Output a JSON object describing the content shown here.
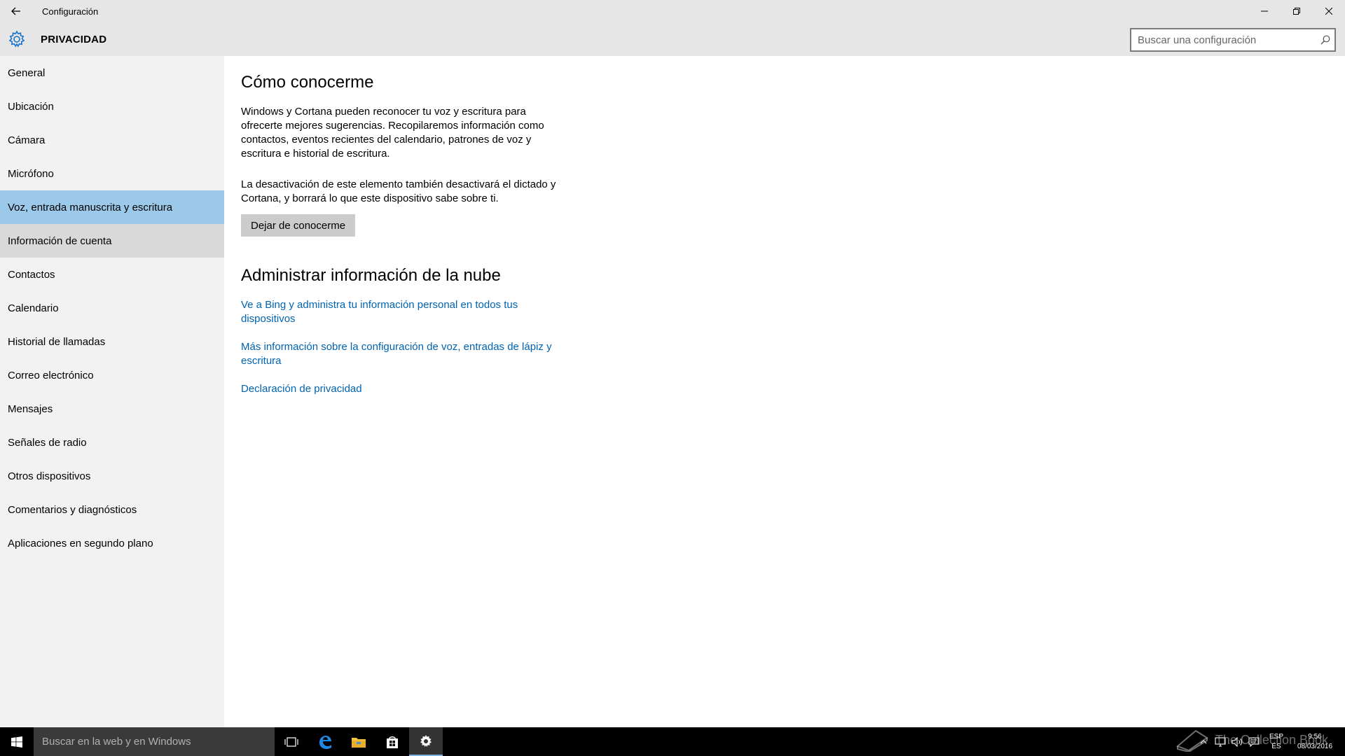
{
  "window": {
    "title": "Configuración"
  },
  "header": {
    "title": "PRIVACIDAD",
    "search_placeholder": "Buscar una configuración"
  },
  "sidebar": {
    "items": [
      {
        "label": "General"
      },
      {
        "label": "Ubicación"
      },
      {
        "label": "Cámara"
      },
      {
        "label": "Micrófono"
      },
      {
        "label": "Voz, entrada manuscrita y escritura"
      },
      {
        "label": "Información de cuenta"
      },
      {
        "label": "Contactos"
      },
      {
        "label": "Calendario"
      },
      {
        "label": "Historial de llamadas"
      },
      {
        "label": "Correo electrónico"
      },
      {
        "label": "Mensajes"
      },
      {
        "label": "Señales de radio"
      },
      {
        "label": "Otros dispositivos"
      },
      {
        "label": "Comentarios y diagnósticos"
      },
      {
        "label": "Aplicaciones en segundo plano"
      }
    ],
    "selected": "Voz, entrada manuscrita y escritura"
  },
  "main": {
    "section1_title": "Cómo conocerme",
    "section1_text": "Windows y Cortana pueden reconocer tu voz y escritura para ofrecerte mejores sugerencias. Recopilaremos información como contactos, eventos recientes del calendario, patrones de voz y escritura e historial de escritura.",
    "section1_warning": "La desactivación de este elemento también desactivará el dictado y Cortana, y borrará lo que este dispositivo sabe sobre ti.",
    "button_label": "Dejar de conocerme",
    "section2_title": "Administrar información de la nube",
    "links": [
      "Ve a Bing y administra tu información personal en todos tus dispositivos",
      "Más información sobre la configuración de voz, entradas de lápiz y escritura",
      "Declaración de privacidad"
    ]
  },
  "taskbar": {
    "search_text": "Buscar en la web y en Windows",
    "lang_top": "ESP",
    "lang_bottom": "ES",
    "time": "9:56",
    "date": "08/03/2016",
    "watermark": "The Collection Book"
  },
  "colors": {
    "accent": "#0063b1",
    "selected": "#9cc8ea",
    "hover": "#d9d9d9",
    "chrome": "#e6e6e6",
    "sidebar": "#f2f2f2"
  }
}
